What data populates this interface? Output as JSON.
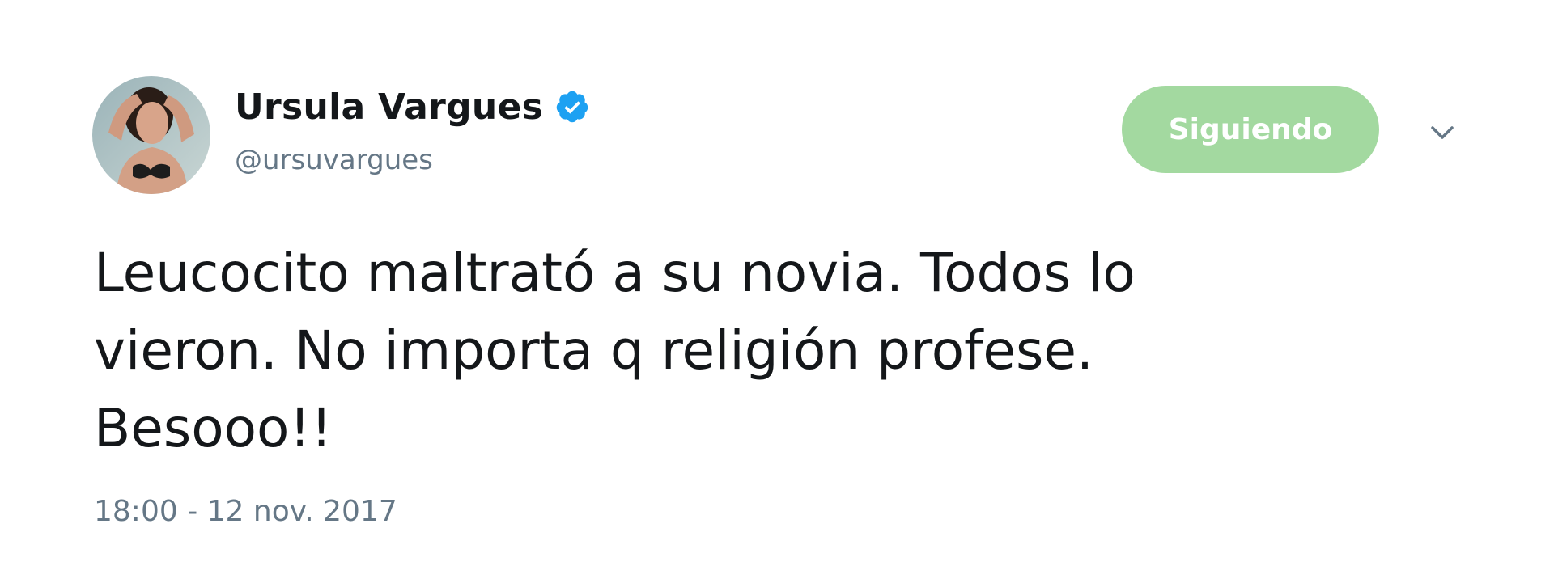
{
  "user": {
    "display_name": "Ursula Vargues",
    "handle": "@ursuvargues",
    "verified": true,
    "avatar_icon": "profile-photo-avatar"
  },
  "actions": {
    "follow_label": "Siguiendo",
    "caret_icon": "chevron-down-icon"
  },
  "tweet": {
    "text_lines": [
      "Leucocito maltrató a su novia. Todos lo",
      "vieron. No importa q religión profese.",
      "Besooo!!"
    ],
    "timestamp": "18:00 - 12 nov. 2017"
  },
  "colors": {
    "text_primary": "#14171a",
    "text_secondary": "#657786",
    "follow_button_bg": "#a3d9a0",
    "verified_blue": "#1da1f2"
  }
}
